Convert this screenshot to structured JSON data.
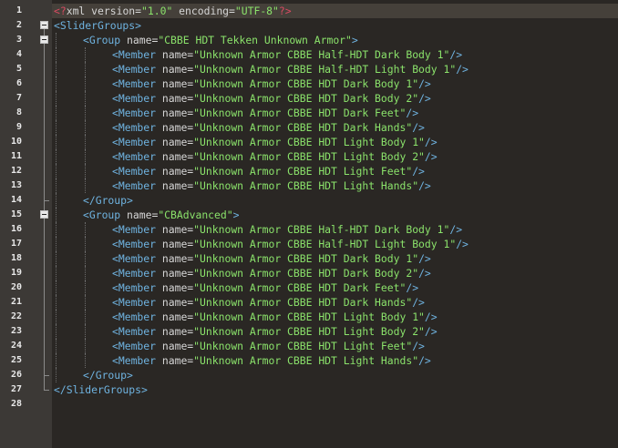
{
  "editor": {
    "colors": {
      "background": "#2a2724",
      "gutter": "#3c3936",
      "current_line": "#45403a",
      "line_number": "#e8e8e8",
      "tag": "#6fb3e0",
      "attribute": "#d6d6d6",
      "value": "#8be36b",
      "processing_instruction": "#d94a62"
    },
    "fold_icon": "minus-box-icon",
    "lines": [
      {
        "n": "1",
        "indent": 0,
        "fold": "none",
        "tokens": [
          {
            "t": "pi",
            "v": "<?"
          },
          {
            "t": "attr",
            "v": "xml version="
          },
          {
            "t": "val",
            "v": "\"1.0\""
          },
          {
            "t": "attr",
            "v": " encoding="
          },
          {
            "t": "val",
            "v": "\"UTF-8\""
          },
          {
            "t": "pi",
            "v": "?>"
          }
        ]
      },
      {
        "n": "2",
        "indent": 0,
        "fold": "open",
        "tokens": [
          {
            "t": "tag",
            "v": "<SliderGroups>"
          }
        ]
      },
      {
        "n": "3",
        "indent": 1,
        "fold": "open",
        "tokens": [
          {
            "t": "tag",
            "v": "<Group "
          },
          {
            "t": "attr",
            "v": "name="
          },
          {
            "t": "val",
            "v": "\"CBBE HDT Tekken Unknown Armor\""
          },
          {
            "t": "tag",
            "v": ">"
          }
        ]
      },
      {
        "n": "4",
        "indent": 2,
        "fold": "line",
        "tokens": [
          {
            "t": "tag",
            "v": "<Member "
          },
          {
            "t": "attr",
            "v": "name="
          },
          {
            "t": "val",
            "v": "\"Unknown Armor CBBE Half-HDT Dark Body 1\""
          },
          {
            "t": "tag",
            "v": "/>"
          }
        ]
      },
      {
        "n": "5",
        "indent": 2,
        "fold": "line",
        "tokens": [
          {
            "t": "tag",
            "v": "<Member "
          },
          {
            "t": "attr",
            "v": "name="
          },
          {
            "t": "val",
            "v": "\"Unknown Armor CBBE Half-HDT Light Body 1\""
          },
          {
            "t": "tag",
            "v": "/>"
          }
        ]
      },
      {
        "n": "6",
        "indent": 2,
        "fold": "line",
        "tokens": [
          {
            "t": "tag",
            "v": "<Member "
          },
          {
            "t": "attr",
            "v": "name="
          },
          {
            "t": "val",
            "v": "\"Unknown Armor CBBE HDT Dark Body 1\""
          },
          {
            "t": "tag",
            "v": "/>"
          }
        ]
      },
      {
        "n": "7",
        "indent": 2,
        "fold": "line",
        "tokens": [
          {
            "t": "tag",
            "v": "<Member "
          },
          {
            "t": "attr",
            "v": "name="
          },
          {
            "t": "val",
            "v": "\"Unknown Armor CBBE HDT Dark Body 2\""
          },
          {
            "t": "tag",
            "v": "/>"
          }
        ]
      },
      {
        "n": "8",
        "indent": 2,
        "fold": "line",
        "tokens": [
          {
            "t": "tag",
            "v": "<Member "
          },
          {
            "t": "attr",
            "v": "name="
          },
          {
            "t": "val",
            "v": "\"Unknown Armor CBBE HDT Dark Feet\""
          },
          {
            "t": "tag",
            "v": "/>"
          }
        ]
      },
      {
        "n": "9",
        "indent": 2,
        "fold": "line",
        "tokens": [
          {
            "t": "tag",
            "v": "<Member "
          },
          {
            "t": "attr",
            "v": "name="
          },
          {
            "t": "val",
            "v": "\"Unknown Armor CBBE HDT Dark Hands\""
          },
          {
            "t": "tag",
            "v": "/>"
          }
        ]
      },
      {
        "n": "10",
        "indent": 2,
        "fold": "line",
        "tokens": [
          {
            "t": "tag",
            "v": "<Member "
          },
          {
            "t": "attr",
            "v": "name="
          },
          {
            "t": "val",
            "v": "\"Unknown Armor CBBE HDT Light Body 1\""
          },
          {
            "t": "tag",
            "v": "/>"
          }
        ]
      },
      {
        "n": "11",
        "indent": 2,
        "fold": "line",
        "tokens": [
          {
            "t": "tag",
            "v": "<Member "
          },
          {
            "t": "attr",
            "v": "name="
          },
          {
            "t": "val",
            "v": "\"Unknown Armor CBBE HDT Light Body 2\""
          },
          {
            "t": "tag",
            "v": "/>"
          }
        ]
      },
      {
        "n": "12",
        "indent": 2,
        "fold": "line",
        "tokens": [
          {
            "t": "tag",
            "v": "<Member "
          },
          {
            "t": "attr",
            "v": "name="
          },
          {
            "t": "val",
            "v": "\"Unknown Armor CBBE HDT Light Feet\""
          },
          {
            "t": "tag",
            "v": "/>"
          }
        ]
      },
      {
        "n": "13",
        "indent": 2,
        "fold": "line",
        "tokens": [
          {
            "t": "tag",
            "v": "<Member "
          },
          {
            "t": "attr",
            "v": "name="
          },
          {
            "t": "val",
            "v": "\"Unknown Armor CBBE HDT Light Hands\""
          },
          {
            "t": "tag",
            "v": "/>"
          }
        ]
      },
      {
        "n": "14",
        "indent": 1,
        "fold": "end",
        "tokens": [
          {
            "t": "tag",
            "v": "</Group>"
          }
        ]
      },
      {
        "n": "15",
        "indent": 1,
        "fold": "open",
        "tokens": [
          {
            "t": "tag",
            "v": "<Group "
          },
          {
            "t": "attr",
            "v": "name="
          },
          {
            "t": "val",
            "v": "\"CBAdvanced\""
          },
          {
            "t": "tag",
            "v": ">"
          }
        ]
      },
      {
        "n": "16",
        "indent": 2,
        "fold": "line",
        "tokens": [
          {
            "t": "tag",
            "v": "<Member "
          },
          {
            "t": "attr",
            "v": "name="
          },
          {
            "t": "val",
            "v": "\"Unknown Armor CBBE Half-HDT Dark Body 1\""
          },
          {
            "t": "tag",
            "v": "/>"
          }
        ]
      },
      {
        "n": "17",
        "indent": 2,
        "fold": "line",
        "tokens": [
          {
            "t": "tag",
            "v": "<Member "
          },
          {
            "t": "attr",
            "v": "name="
          },
          {
            "t": "val",
            "v": "\"Unknown Armor CBBE Half-HDT Light Body 1\""
          },
          {
            "t": "tag",
            "v": "/>"
          }
        ]
      },
      {
        "n": "18",
        "indent": 2,
        "fold": "line",
        "tokens": [
          {
            "t": "tag",
            "v": "<Member "
          },
          {
            "t": "attr",
            "v": "name="
          },
          {
            "t": "val",
            "v": "\"Unknown Armor CBBE HDT Dark Body 1\""
          },
          {
            "t": "tag",
            "v": "/>"
          }
        ]
      },
      {
        "n": "19",
        "indent": 2,
        "fold": "line",
        "tokens": [
          {
            "t": "tag",
            "v": "<Member "
          },
          {
            "t": "attr",
            "v": "name="
          },
          {
            "t": "val",
            "v": "\"Unknown Armor CBBE HDT Dark Body 2\""
          },
          {
            "t": "tag",
            "v": "/>"
          }
        ]
      },
      {
        "n": "20",
        "indent": 2,
        "fold": "line",
        "tokens": [
          {
            "t": "tag",
            "v": "<Member "
          },
          {
            "t": "attr",
            "v": "name="
          },
          {
            "t": "val",
            "v": "\"Unknown Armor CBBE HDT Dark Feet\""
          },
          {
            "t": "tag",
            "v": "/>"
          }
        ]
      },
      {
        "n": "21",
        "indent": 2,
        "fold": "line",
        "tokens": [
          {
            "t": "tag",
            "v": "<Member "
          },
          {
            "t": "attr",
            "v": "name="
          },
          {
            "t": "val",
            "v": "\"Unknown Armor CBBE HDT Dark Hands\""
          },
          {
            "t": "tag",
            "v": "/>"
          }
        ]
      },
      {
        "n": "22",
        "indent": 2,
        "fold": "line",
        "tokens": [
          {
            "t": "tag",
            "v": "<Member "
          },
          {
            "t": "attr",
            "v": "name="
          },
          {
            "t": "val",
            "v": "\"Unknown Armor CBBE HDT Light Body 1\""
          },
          {
            "t": "tag",
            "v": "/>"
          }
        ]
      },
      {
        "n": "23",
        "indent": 2,
        "fold": "line",
        "tokens": [
          {
            "t": "tag",
            "v": "<Member "
          },
          {
            "t": "attr",
            "v": "name="
          },
          {
            "t": "val",
            "v": "\"Unknown Armor CBBE HDT Light Body 2\""
          },
          {
            "t": "tag",
            "v": "/>"
          }
        ]
      },
      {
        "n": "24",
        "indent": 2,
        "fold": "line",
        "tokens": [
          {
            "t": "tag",
            "v": "<Member "
          },
          {
            "t": "attr",
            "v": "name="
          },
          {
            "t": "val",
            "v": "\"Unknown Armor CBBE HDT Light Feet\""
          },
          {
            "t": "tag",
            "v": "/>"
          }
        ]
      },
      {
        "n": "25",
        "indent": 2,
        "fold": "line",
        "tokens": [
          {
            "t": "tag",
            "v": "<Member "
          },
          {
            "t": "attr",
            "v": "name="
          },
          {
            "t": "val",
            "v": "\"Unknown Armor CBBE HDT Light Hands\""
          },
          {
            "t": "tag",
            "v": "/>"
          }
        ]
      },
      {
        "n": "26",
        "indent": 1,
        "fold": "end",
        "tokens": [
          {
            "t": "tag",
            "v": "</Group>"
          }
        ]
      },
      {
        "n": "27",
        "indent": 0,
        "fold": "end",
        "tokens": [
          {
            "t": "tag",
            "v": "</SliderGroups>"
          }
        ]
      },
      {
        "n": "28",
        "indent": 0,
        "fold": "none",
        "tokens": []
      }
    ]
  }
}
